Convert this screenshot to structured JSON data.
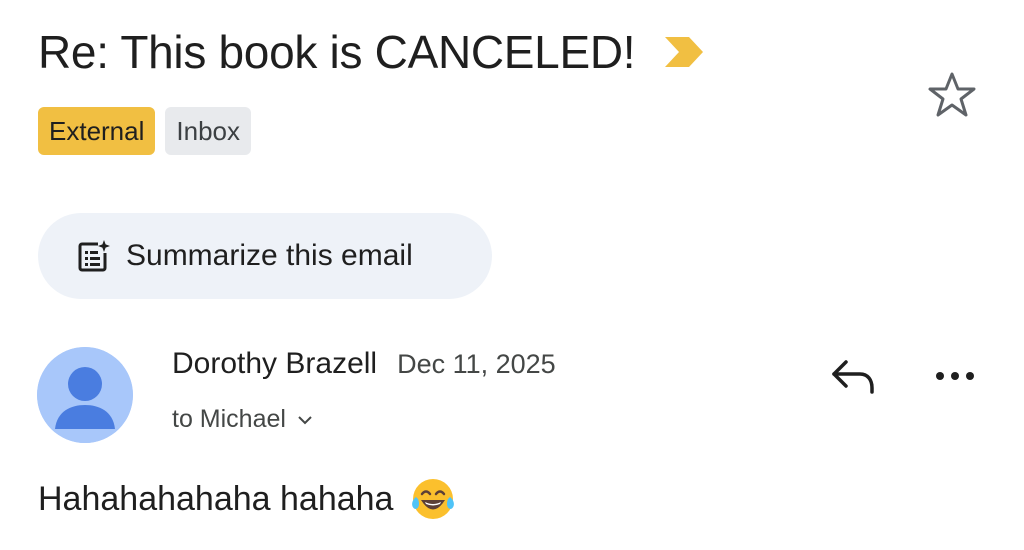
{
  "email": {
    "subject": "Re: This book is CANCELED!",
    "labels": [
      {
        "text": "External",
        "color": "#f1bf42"
      },
      {
        "text": "Inbox",
        "color": "#e8eaed"
      }
    ],
    "importance_marker_color": "#f1bf42",
    "starred": false,
    "summarize_button_label": "Summarize this email",
    "sender_name": "Dorothy Brazell",
    "sent_date": "Dec 11, 2025",
    "recipient_text": "to Michael",
    "body_text": "Hahahahahaha hahaha",
    "body_emoji": "face-with-tears-of-joy-icon"
  },
  "icons": {
    "importance": "importance-marker-icon",
    "star": "star-outline-icon",
    "summarize": "summarize-sparkle-icon",
    "avatar": "default-avatar-icon",
    "chevron": "chevron-down-icon",
    "reply": "reply-icon",
    "more": "more-horizontal-icon"
  }
}
